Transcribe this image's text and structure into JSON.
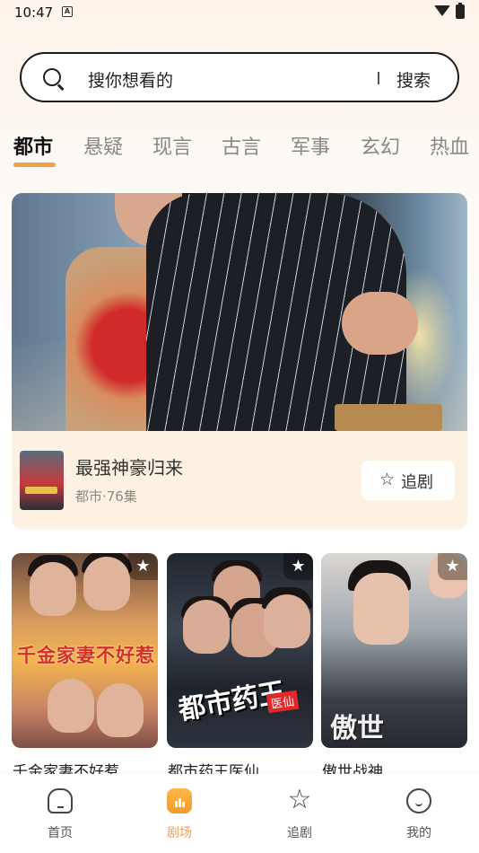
{
  "status_bar": {
    "time": "10:47",
    "notif_glyph": "A"
  },
  "search": {
    "placeholder": "搜你想看的",
    "button_label": "搜索"
  },
  "tabs": [
    {
      "label": "都市",
      "active": true
    },
    {
      "label": "悬疑"
    },
    {
      "label": "现言"
    },
    {
      "label": "古言"
    },
    {
      "label": "军事"
    },
    {
      "label": "玄幻"
    },
    {
      "label": "热血"
    }
  ],
  "featured": {
    "title": "最强神豪归来",
    "meta": "都市·76集",
    "follow_label": "追剧",
    "star_glyph": "☆"
  },
  "dramas": [
    {
      "title": "千金家妻不好惹",
      "cover_text": "千金家妻不好惹"
    },
    {
      "title": "都市药王医仙",
      "cover_text": "都市药王",
      "cover_tag": "医仙"
    },
    {
      "title": "傲世战神",
      "cover_text": "傲世"
    }
  ],
  "favorite_glyph": "★",
  "bottom_nav": [
    {
      "label": "首页",
      "icon": "home-icon"
    },
    {
      "label": "剧场",
      "icon": "theater-icon",
      "active": true
    },
    {
      "label": "追剧",
      "icon": "star-icon"
    },
    {
      "label": "我的",
      "icon": "profile-icon"
    }
  ],
  "colors": {
    "accent": "#f0a24a",
    "text": "#222222",
    "muted": "#888888",
    "card_bg": "#fdf1e3"
  }
}
